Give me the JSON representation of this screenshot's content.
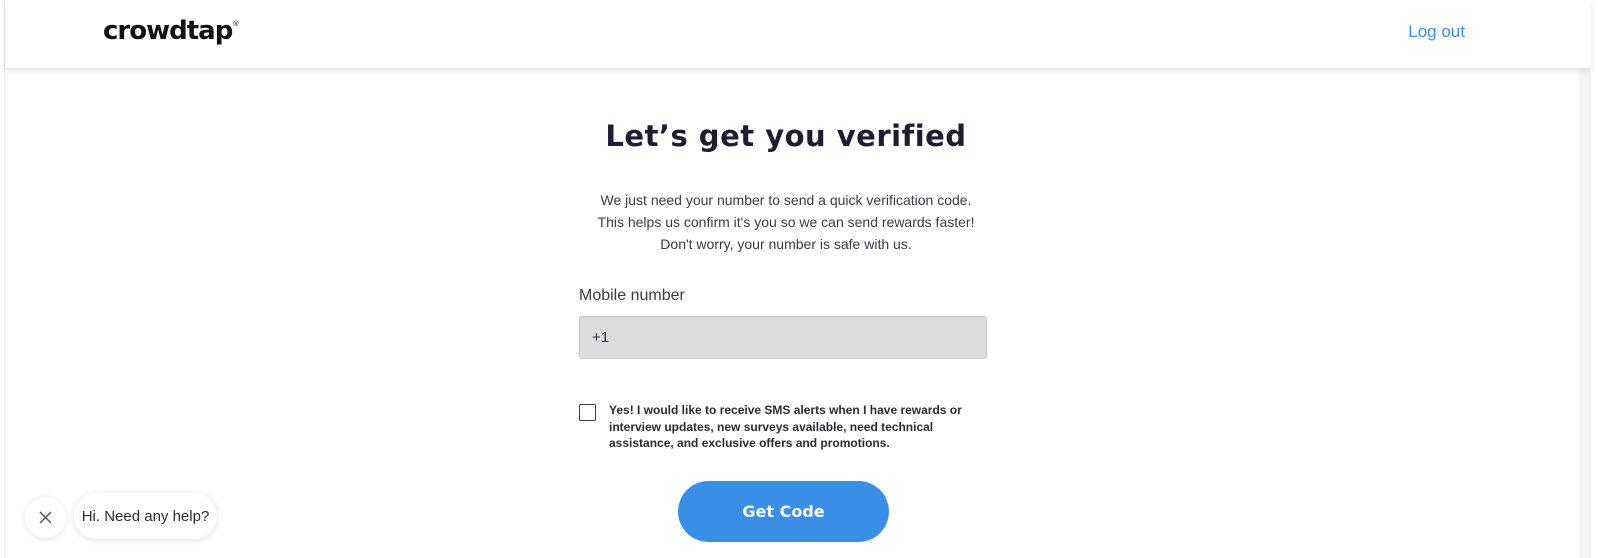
{
  "header": {
    "logo_text": "crowdtap",
    "logo_mark": "®",
    "logout_label": "Log out"
  },
  "main": {
    "title": "Let’s get you verified",
    "intro_lines": [
      "We just need your number to send a quick verification code.",
      "This helps us confirm it's you so we can send rewards faster!",
      "Don't worry, your number is safe with us."
    ],
    "mobile_label": "Mobile number",
    "mobile_value": "+1",
    "sms_consent_checked": false,
    "sms_consent_text": "Yes! I would like to receive SMS alerts when I have rewards or interview updates, new surveys available, need technical assistance, and exclusive offers and promotions.",
    "get_code_label": "Get Code"
  },
  "chat_widget": {
    "close_icon": "close-icon",
    "message": "Hi. Need any help?"
  },
  "colors": {
    "accent": "#3a8ee6",
    "input_bg": "#dcdcdf",
    "heading": "#1c1c33"
  }
}
